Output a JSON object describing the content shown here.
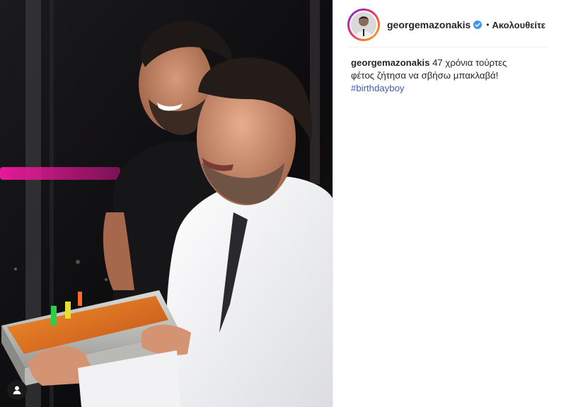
{
  "post": {
    "photo_description": "Two men smiling, one holding a tray of baklava with candles",
    "tag_people_icon": "user-tag-icon"
  },
  "header": {
    "username": "georgemazonakis",
    "verified_icon": "verified-badge-icon",
    "separator": "•",
    "follow_label": "Ακολουθείτε"
  },
  "caption": {
    "username": "georgemazonakis",
    "text": "47 χρόνια τούρτες φέτος ζήτησα να σβήσω μπακλαβά!",
    "hashtag": "#birthdayboy"
  },
  "colors": {
    "hashtag": "#3f5cb0",
    "verified": "#3897f0",
    "text": "#262626"
  }
}
